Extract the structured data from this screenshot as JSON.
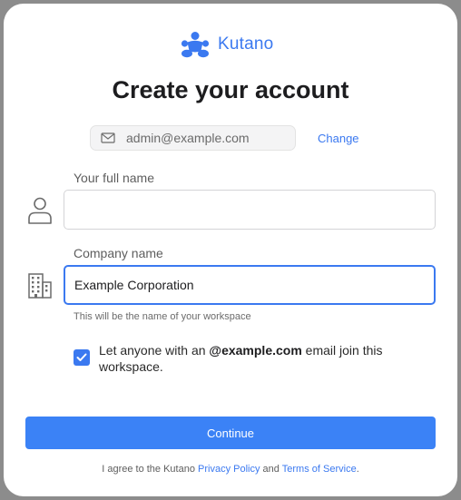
{
  "brand": {
    "name": "Kutano",
    "logo_icon": "people-group-icon",
    "accent": "#3b79f0"
  },
  "title": "Create your account",
  "account": {
    "email": "admin@example.com",
    "icon": "mail-icon",
    "change_label": "Change"
  },
  "full_name": {
    "label": "Your full name",
    "value": "",
    "icon": "person-icon"
  },
  "company": {
    "label": "Company name",
    "value": "Example Corporation",
    "hint": "This will be the name of your workspace",
    "icon": "building-icon"
  },
  "join_option": {
    "checked": true,
    "prefix": "Let anyone with an ",
    "domain": "@example.com",
    "suffix": " email join this workspace."
  },
  "continue_label": "Continue",
  "legal": {
    "prefix": "I agree to the Kutano ",
    "privacy_label": "Privacy Policy",
    "middle": " and ",
    "terms_label": "Terms of Service",
    "suffix": "."
  }
}
